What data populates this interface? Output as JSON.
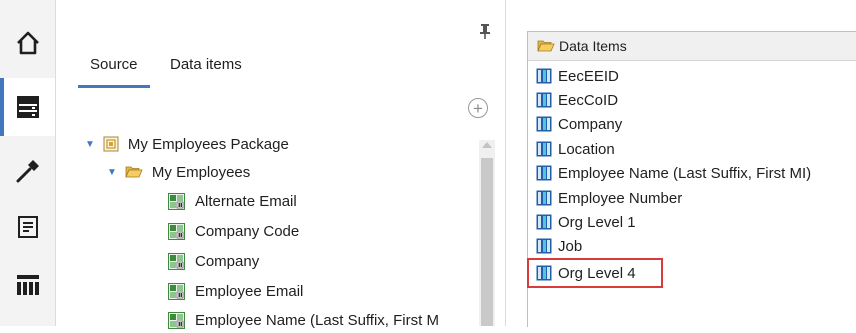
{
  "tabs": {
    "source": "Source",
    "data_items": "Data items"
  },
  "source_tree": [
    {
      "label": "My Employees Package",
      "icon": "package-icon",
      "level": 0,
      "expanded": true
    },
    {
      "label": "My Employees",
      "icon": "folder-open-icon",
      "level": 1,
      "expanded": true
    },
    {
      "label": "Alternate Email",
      "icon": "query-item-icon",
      "level": 2
    },
    {
      "label": "Company Code",
      "icon": "query-item-icon",
      "level": 2
    },
    {
      "label": "Company",
      "icon": "query-item-icon",
      "level": 2
    },
    {
      "label": "Employee Email",
      "icon": "query-item-icon",
      "level": 2
    },
    {
      "label": "Employee Name (Last Suffix, First M",
      "icon": "query-item-icon",
      "level": 2
    }
  ],
  "data_items_panel": {
    "header": "Data Items",
    "items": [
      "EecEEID",
      "EecCoID",
      "Company",
      "Location",
      "Employee Name (Last Suffix, First MI)",
      "Employee Number",
      "Org Level 1",
      "Job",
      "Org Level 4"
    ],
    "highlighted": "Org Level 4",
    "highlight_color": "#d93a3a"
  },
  "colors": {
    "accent": "#4178be"
  }
}
